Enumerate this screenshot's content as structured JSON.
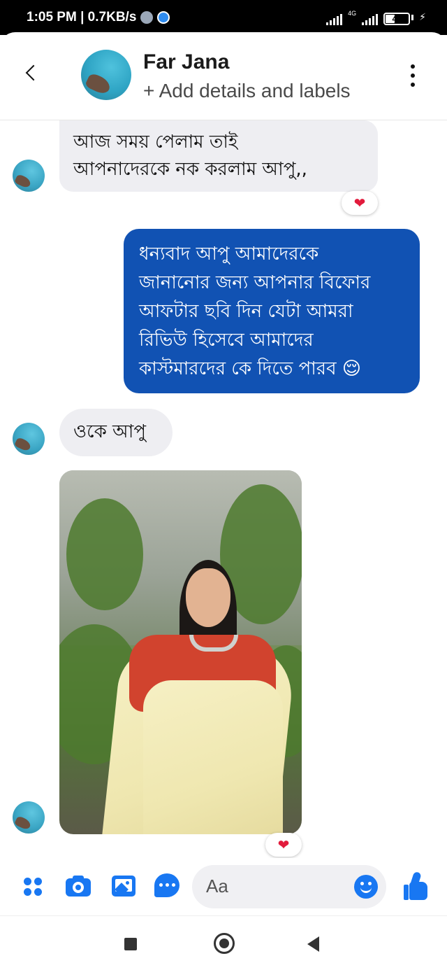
{
  "status_bar": {
    "time_speed": "1:05 PM | 0.7KB/s",
    "network_tag": "4G",
    "battery": "41",
    "battery_percent": 41
  },
  "header": {
    "contact_name": "Far Jana",
    "subtitle": "+ Add details and labels"
  },
  "messages": [
    {
      "direction": "incoming",
      "lines": [
        "আজ সময় পেলাম  তাই",
        "আপনাদেরকে নক করলাম আপু,,"
      ],
      "reaction": "heart"
    },
    {
      "direction": "outgoing",
      "lines": [
        "ধন্যবাদ আপু আমাদেরকে",
        "জানানোর জন্য আপনার বিফোর",
        "আফটার ছবি দিন যেটা আমরা",
        "রিভিউ হিসেবে আমাদের",
        "কাস্টমারদের কে দিতে পারব"
      ],
      "emoji": "😌"
    },
    {
      "direction": "incoming",
      "lines": [
        "ওকে আপু"
      ]
    },
    {
      "direction": "incoming",
      "type": "photo",
      "reaction": "heart"
    }
  ],
  "composer": {
    "placeholder": "Aa"
  },
  "icons": {
    "reaction_heart": "❤"
  },
  "colors": {
    "accent": "#1877f2",
    "outgoing_bubble": "#1152b3",
    "incoming_bubble": "#eeeef2",
    "heart": "#e21b3c"
  }
}
